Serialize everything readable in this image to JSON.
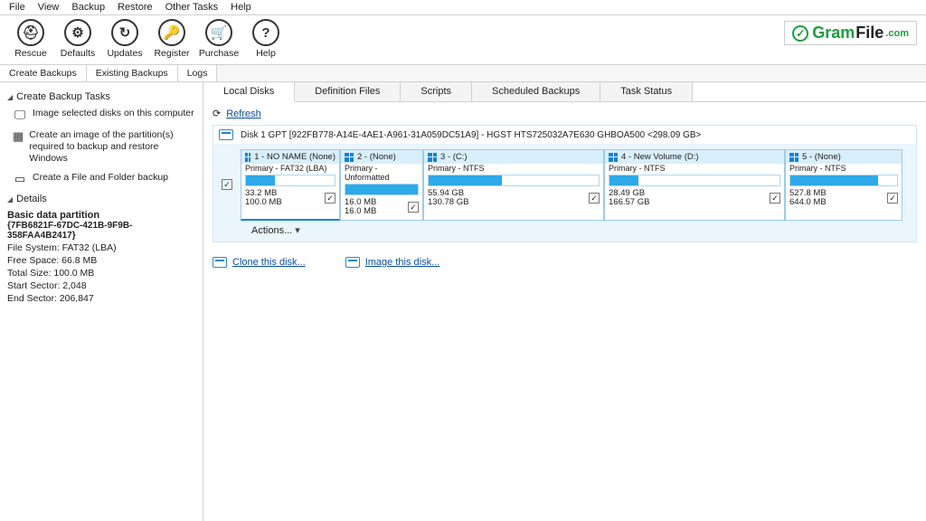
{
  "menu": {
    "items": [
      "File",
      "View",
      "Backup",
      "Restore",
      "Other Tasks",
      "Help"
    ]
  },
  "toolbar": {
    "buttons": [
      {
        "name": "rescue",
        "label": "Rescue",
        "glyph": "⛑"
      },
      {
        "name": "defaults",
        "label": "Defaults",
        "glyph": "⚙"
      },
      {
        "name": "updates",
        "label": "Updates",
        "glyph": "↻"
      },
      {
        "name": "register",
        "label": "Register",
        "glyph": "🔑"
      },
      {
        "name": "purchase",
        "label": "Purchase",
        "glyph": "🛒"
      },
      {
        "name": "help",
        "label": "Help",
        "glyph": "?"
      }
    ],
    "brand": {
      "text1": "Gram",
      "text2": "File",
      "suffix": ".com"
    }
  },
  "sub_tabs": [
    "Create Backups",
    "Existing Backups",
    "Logs"
  ],
  "left": {
    "create_head": "Create Backup Tasks",
    "task1": "Image selected disks on this computer",
    "task2": "Create an image of the partition(s) required to backup and restore Windows",
    "task3": "Create a File and Folder backup",
    "details_head": "Details",
    "part_title": "Basic data partition",
    "part_guid": "{7FB6821F-67DC-421B-9F9B-358FAA4B2417}",
    "fs": "File System: FAT32 (LBA)",
    "free": "Free Space:   66.8 MB",
    "total": "Total Size:   100.0 MB",
    "start": "Start Sector:  2,048",
    "end": "End Sector:   206,847"
  },
  "view_tabs": [
    "Local Disks",
    "Definition Files",
    "Scripts",
    "Scheduled Backups",
    "Task Status"
  ],
  "refresh_label": "Refresh",
  "disk": {
    "header": "Disk 1 GPT [922FB778-A14E-4AE1-A961-31A059DC51A9] - HGST HTS725032A7E630 GHBOA500  <298.09 GB>",
    "actions": "Actions...",
    "partitions": [
      {
        "title": "1 - NO NAME (None)",
        "sub": "Primary - FAT32 (LBA)",
        "used": "33.2 MB",
        "total": "100.0 MB",
        "fill": 33,
        "selected": true
      },
      {
        "title": "2 -  (None)",
        "sub": "Primary - Unformatted",
        "used": "16.0 MB",
        "total": "16.0 MB",
        "fill": 100
      },
      {
        "title": "3 -  (C:)",
        "sub": "Primary - NTFS",
        "used": "55.94 GB",
        "total": "130.78 GB",
        "fill": 43
      },
      {
        "title": "4 - New Volume (D:)",
        "sub": "Primary - NTFS",
        "used": "28.49 GB",
        "total": "166.57 GB",
        "fill": 17
      },
      {
        "title": "5 -  (None)",
        "sub": "Primary - NTFS",
        "used": "527.8 MB",
        "total": "644.0 MB",
        "fill": 82
      }
    ]
  },
  "links": {
    "clone": "Clone this disk...",
    "image": "Image this disk..."
  }
}
